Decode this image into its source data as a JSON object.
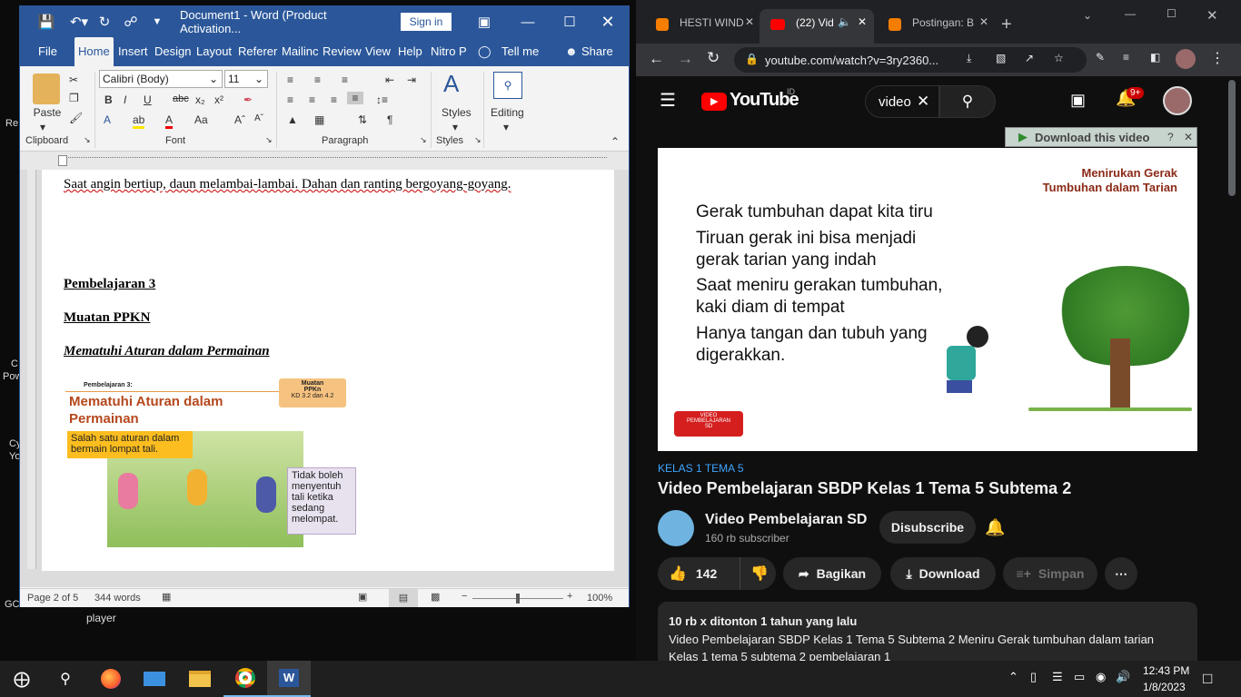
{
  "desktop": {
    "left_labels": [
      "Re",
      "C",
      "Pow",
      "Cy",
      "Yo",
      "GC"
    ],
    "player_label": "player"
  },
  "word": {
    "title": "Document1 - Word (Product Activation...",
    "sign_in": "Sign in",
    "tabs": [
      "File",
      "Home",
      "Insert",
      "Design",
      "Layout",
      "Referer",
      "Mailinc",
      "Review",
      "View",
      "Help",
      "Nitro P"
    ],
    "tell_me": "Tell me",
    "share": "Share",
    "ribbon": {
      "paste": "Paste",
      "font_name": "Calibri (Body)",
      "font_size": "11",
      "styles": "Styles",
      "editing": "Editing",
      "groups": {
        "clipboard": "Clipboard",
        "font": "Font",
        "paragraph": "Paragraph",
        "styles": "Styles"
      }
    },
    "page": {
      "line1": "Saat angin bertiup, daun melambai-lambai. Dahan dan ranting bergoyang-goyang.",
      "h1": "Pembelajaran 3",
      "h2": "Muatan PPKN",
      "h3": "Mematuhi Aturan dalam Permainan"
    },
    "picture": {
      "small_label": "Pembelajaran 3:",
      "title1": "Mematuhi Aturan dalam",
      "title2": "Permainan",
      "muatan": "Muatan",
      "ppkn": "PPKn",
      "kd": "KD 3.2 dan 4.2",
      "rule": "Salah satu aturan dalam bermain lompat tali.",
      "note": "Tidak boleh menyentuh tali ketika sedang melompat."
    },
    "status": {
      "page": "Page 2 of 5",
      "words": "344 words",
      "zoom": "100%",
      "zoom_level": 0.5
    }
  },
  "chrome": {
    "tabs": [
      {
        "label": "HESTI WIND",
        "icon": "blogger-icon"
      },
      {
        "label": "(22) Vid",
        "icon": "youtube-icon"
      },
      {
        "label": "Postingan: B",
        "icon": "blogger-icon"
      }
    ],
    "url": "youtube.com/watch?v=3ry2360...",
    "yt": {
      "logo": "YouTube",
      "region": "ID",
      "search_value": "video",
      "notif": "9+",
      "download_bar": "Download this video",
      "slide": {
        "heading1": "Menirukan Gerak",
        "heading2": "Tumbuhan dalam Tarian",
        "lines": [
          "Gerak tumbuhan dapat kita tiru",
          "Tiruan gerak ini bisa menjadi",
          "gerak tarian yang indah",
          "Saat meniru gerakan tumbuhan,",
          "kaki diam di tempat",
          "Hanya tangan dan tubuh yang",
          "digerakkan."
        ],
        "badge1": "VIDEO",
        "badge2": "PEMBELAJARAN",
        "badge3": "SD"
      },
      "tag": "KELAS 1 TEMA 5",
      "video_title": "Video Pembelajaran SBDP Kelas 1 Tema 5 Subtema 2",
      "channel": "Video Pembelajaran SD",
      "subs": "160 rb subscriber",
      "subscribe": "Disubscribe",
      "likes": "142",
      "share": "Bagikan",
      "download": "Download",
      "save": "Simpan",
      "views": "10 rb x ditonton  1 tahun yang lalu",
      "desc1": "Video Pembelajaran SBDP Kelas 1 Tema 5 Subtema 2 Meniru Gerak tumbuhan dalam tarian",
      "desc2": "Kelas 1 tema 5 subtema 2 pembelajaran 1"
    }
  },
  "taskbar": {
    "time": "12:43 PM",
    "date": "1/8/2023"
  }
}
